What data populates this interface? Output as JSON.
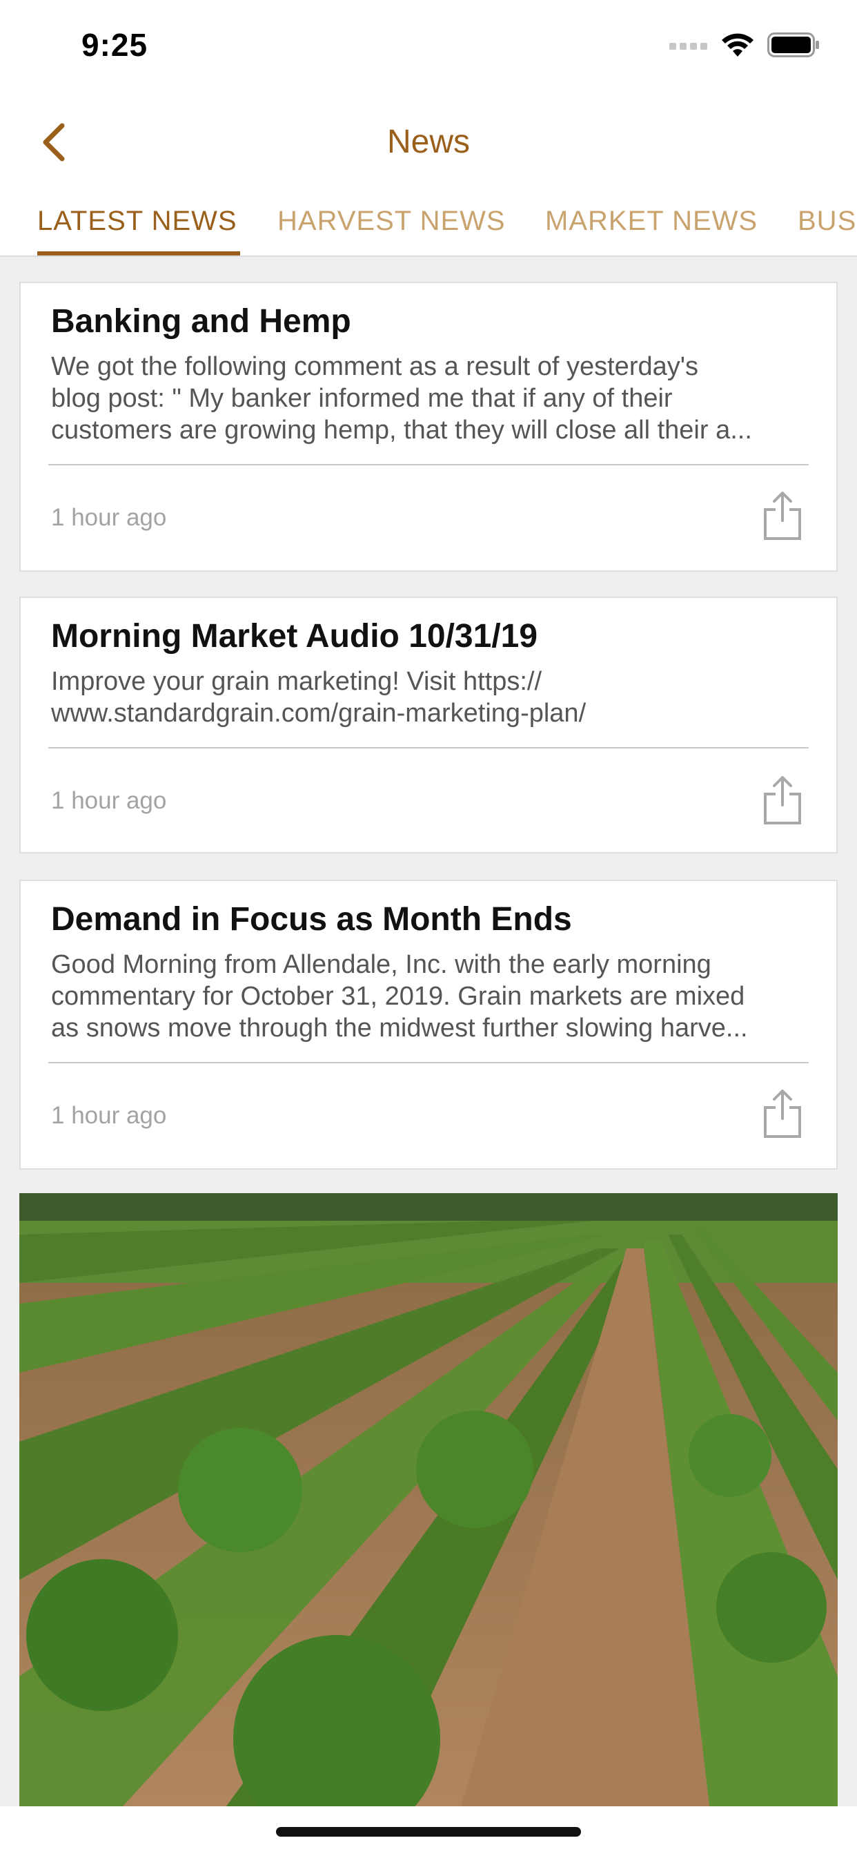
{
  "status_bar": {
    "time": "9:25"
  },
  "nav": {
    "title": "News",
    "back_icon": "chevron-left-icon"
  },
  "tabs": [
    {
      "label": "LATEST NEWS",
      "active": true
    },
    {
      "label": "HARVEST NEWS",
      "active": false
    },
    {
      "label": "MARKET NEWS",
      "active": false
    },
    {
      "label": "BUS",
      "active": false
    }
  ],
  "articles": [
    {
      "title": "Banking and Hemp",
      "lines": [
        "We got the following comment as a result of yesterday's",
        "blog post: \" My banker informed me that if any of their",
        "customers are growing hemp, that they will close all their a..."
      ],
      "time": "1 hour ago"
    },
    {
      "title": "Morning Market Audio 10/31/19",
      "lines": [
        "Improve your grain marketing! Visit https://",
        "www.standardgrain.com/grain-marketing-plan/"
      ],
      "time": "1 hour ago"
    },
    {
      "title": "Demand in Focus as Month Ends",
      "lines": [
        "Good Morning from Allendale, Inc. with the early morning",
        "commentary for October 31, 2019. Grain markets are mixed",
        "as snows move through the midwest further slowing harve..."
      ],
      "time": "1 hour ago"
    }
  ],
  "colors": {
    "accent": "#9a5f1a",
    "tab_inactive": "#c9a36e"
  }
}
